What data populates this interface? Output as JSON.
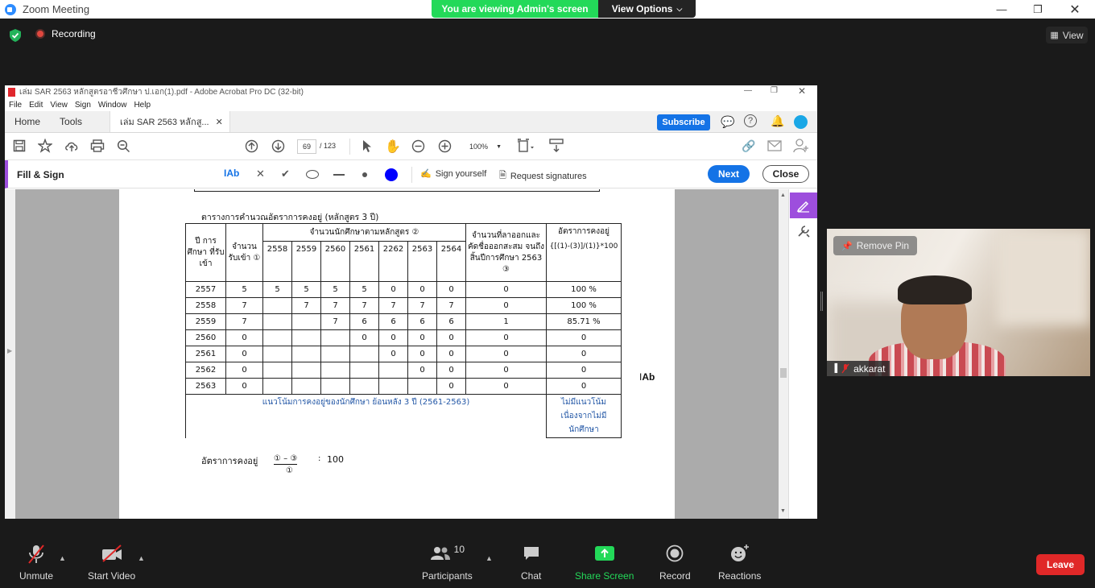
{
  "zoom": {
    "window_title": "Zoom Meeting",
    "banner": "You are viewing Admin's screen",
    "view_options": "View Options",
    "recording": "Recording",
    "view": "View",
    "controls": {
      "unmute": "Unmute",
      "start_video": "Start Video",
      "participants": "Participants",
      "participant_count": "10",
      "chat": "Chat",
      "share_screen": "Share Screen",
      "record": "Record",
      "reactions": "Reactions",
      "leave": "Leave"
    },
    "video": {
      "remove_pin": "Remove Pin",
      "name": "akkarat"
    },
    "colors": {
      "banner_green": "#23d959",
      "share_green": "#23d959",
      "leave_red": "#e02828"
    }
  },
  "acrobat": {
    "title": "เล่ม SAR 2563 หลักสูตรอาชีวศึกษา ป.เอก(1).pdf - Adobe Acrobat Pro DC (32-bit)",
    "menu": [
      "File",
      "Edit",
      "View",
      "Sign",
      "Window",
      "Help"
    ],
    "tabs": {
      "home": "Home",
      "tools": "Tools",
      "doc": "เล่ม SAR 2563 หลักสู..."
    },
    "subscribe": "Subscribe",
    "page_current": "69",
    "page_total": "/ 123",
    "zoom": "100%",
    "fill_sign": {
      "title": "Fill & Sign",
      "text_tool": "Ab",
      "sign_yourself": "Sign yourself",
      "request_signatures": "Request signatures",
      "next": "Next",
      "close": "Close"
    },
    "colors": {
      "accent": "#1473e6",
      "fill_sign": "#9d4edd"
    }
  },
  "pdf": {
    "table_caption": "ตารางการคำนวณอัตราการคงอยู่ (หลักสูตร 3 ปี)",
    "headers": {
      "year": "ปี การศึกษา ที่รับเข้า",
      "admitted": "จำนวน รับเข้า ①",
      "students": "จำนวนนักศึกษาตามหลักสูตร ②",
      "dropped": "จำนวนที่ลาออกและ คัดชื่อออกสะสม จนถึงสิ้นปีการศึกษา 2563 ③",
      "retention": "อัตราการคงอยู่",
      "formula": "{[(1)-(3)]/(1)}*100",
      "years": [
        "2558",
        "2559",
        "2560",
        "2561",
        "2262",
        "2563",
        "2564"
      ]
    },
    "rows": [
      {
        "year": "2557",
        "admitted": "5",
        "cells": [
          "5",
          "5",
          "5",
          "5",
          "0",
          "0",
          "0"
        ],
        "dropped": "0",
        "retention": "100 %"
      },
      {
        "year": "2558",
        "admitted": "7",
        "cells": [
          "",
          "7",
          "7",
          "7",
          "7",
          "7",
          "7"
        ],
        "dropped": "0",
        "retention": "100 %"
      },
      {
        "year": "2559",
        "admitted": "7",
        "cells": [
          "",
          "",
          "7",
          "6",
          "6",
          "6",
          "6"
        ],
        "dropped": "1",
        "retention": "85.71 %"
      },
      {
        "year": "2560",
        "admitted": "0",
        "cells": [
          "",
          "",
          "",
          "0",
          "0",
          "0",
          "0"
        ],
        "dropped": "0",
        "retention": "0"
      },
      {
        "year": "2561",
        "admitted": "0",
        "cells": [
          "",
          "",
          "",
          "",
          "0",
          "0",
          "0"
        ],
        "dropped": "0",
        "retention": "0"
      },
      {
        "year": "2562",
        "admitted": "0",
        "cells": [
          "",
          "",
          "",
          "",
          "",
          "0",
          "0"
        ],
        "dropped": "0",
        "retention": "0"
      },
      {
        "year": "2563",
        "admitted": "0",
        "cells": [
          "",
          "",
          "",
          "",
          "",
          "",
          "0"
        ],
        "dropped": "0",
        "retention": "0"
      }
    ],
    "trend_label": "แนวโน้มการคงอยู่ของนักศึกษา ย้อนหลัง 3 ปี (2561-2563)",
    "trend_value": "ไม่มีแนวโน้ม เนื่องจากไม่มี นักศึกษา",
    "formula_label": "อัตราการคงอยู่",
    "formula_numerator": "① – ③",
    "formula_denominator": "①",
    "formula_times": ":",
    "formula_value": "100",
    "cursor_text": "Ab"
  }
}
